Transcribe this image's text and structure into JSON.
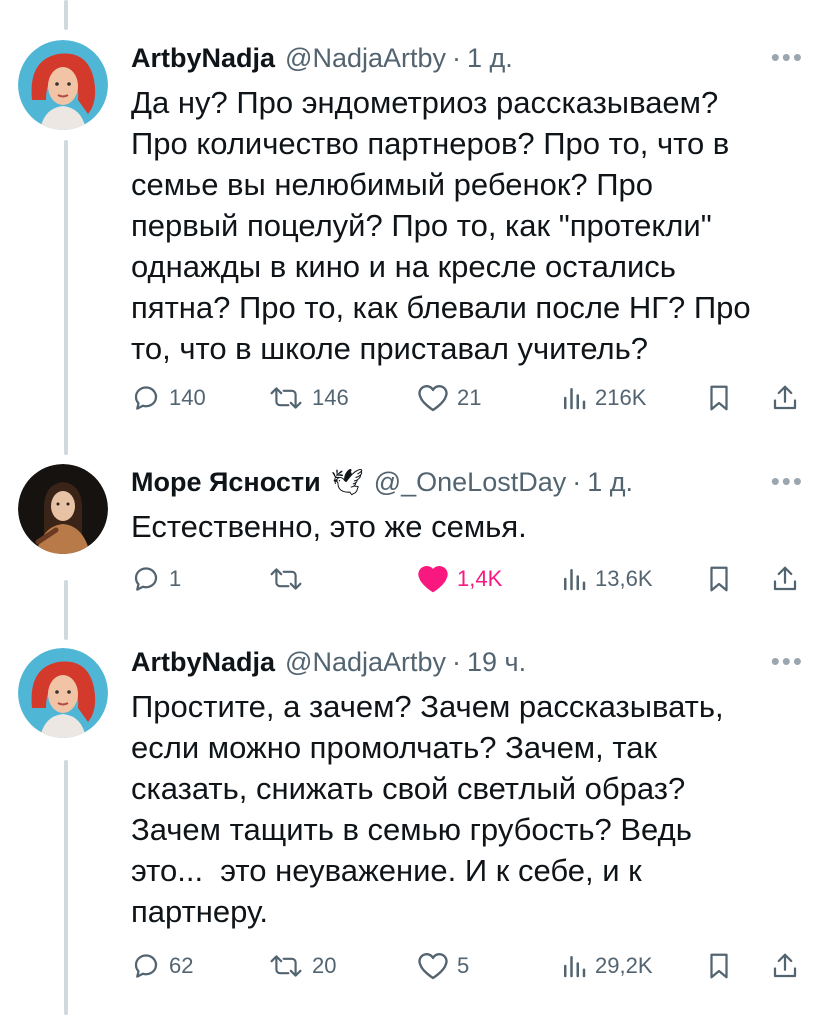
{
  "tweets": [
    {
      "author": {
        "name": "ArtbyNadja",
        "handle": "@NadjaArtby",
        "emoji": ""
      },
      "time": "1 д.",
      "text": "Да ну? Про эндометриоз рассказываем?\nПро количество партнеров? Про то, что в\nсемье вы нелюбимый ребенок? Про\nпервый поцелуй? Про то, как \"протекли\"\nоднажды в кино и на кресле остались\nпятна? Про то, как блевали после НГ? Про\nто, что в школе приставал учитель?",
      "replies": "140",
      "retweets": "146",
      "likes": "21",
      "views": "216K",
      "liked": false
    },
    {
      "author": {
        "name": "Море Ясности",
        "handle": "@_OneLostDay",
        "emoji": "🕊"
      },
      "time": "1 д.",
      "text": "Естественно, это же семья.",
      "replies": "1",
      "retweets": "",
      "likes": "1,4K",
      "views": "13,6K",
      "liked": true
    },
    {
      "author": {
        "name": "ArtbyNadja",
        "handle": "@NadjaArtby",
        "emoji": ""
      },
      "time": "19 ч.",
      "text": "Простите, а зачем? Зачем рассказывать,\nесли можно промолчать? Зачем, так\nсказать, снижать свой светлый образ?\nЗачем тащить в семью грубость? Ведь\nэто...  это неуважение. И к себе, и к\nпартнеру.",
      "replies": "62",
      "retweets": "20",
      "likes": "5",
      "views": "29,2K",
      "liked": false
    }
  ],
  "icons": {
    "reply": "reply-icon",
    "retweet": "retweet-icon",
    "like": "heart-icon",
    "views": "views-icon",
    "bookmark": "bookmark-icon",
    "share": "share-icon",
    "more": "more-icon"
  },
  "colors": {
    "like_active": "#f91880",
    "muted": "#536471",
    "text": "#0f1419",
    "thread_line": "#cfd9de"
  }
}
